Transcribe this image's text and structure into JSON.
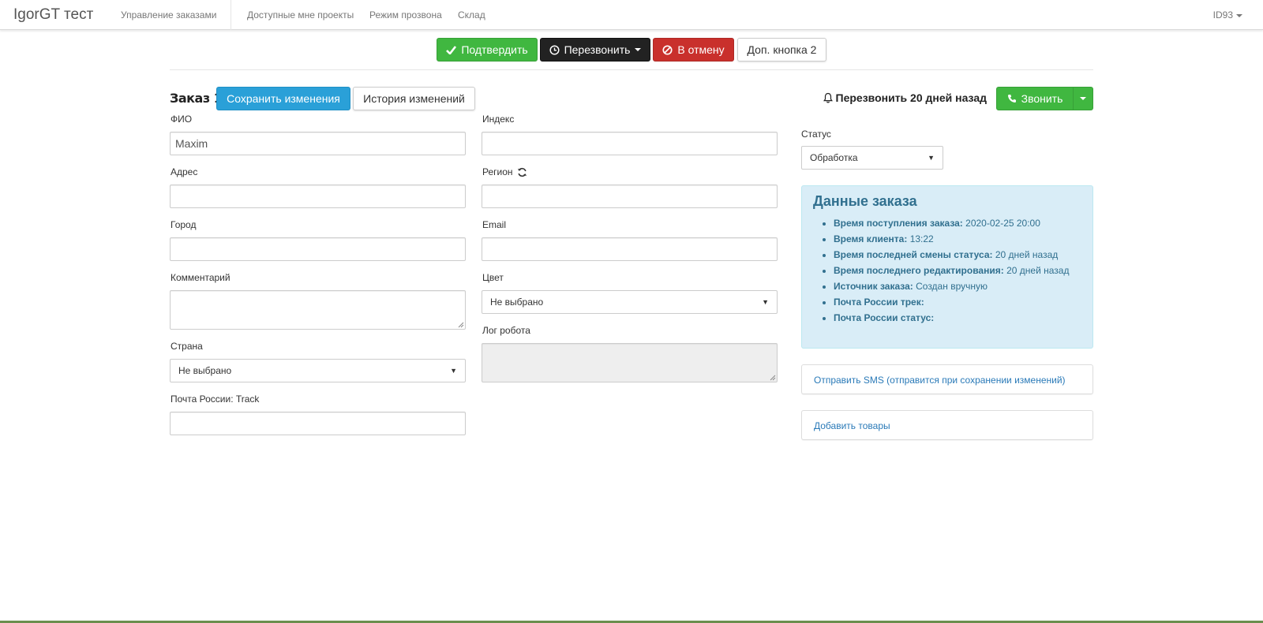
{
  "navbar": {
    "brand": "IgorGT тест",
    "links": [
      "Управление заказами",
      "Доступные мне проекты",
      "Режим прозвона",
      "Склад"
    ],
    "user": "ID93"
  },
  "actions": {
    "confirm": "Подтвердить",
    "callback": "Перезвонить",
    "cancel": "В отмену",
    "extra2": "Доп. кнопка 2"
  },
  "order": {
    "title": "Заказ 19",
    "save": "Сохранить изменения",
    "history": "История изменений",
    "callback_note": "Перезвонить 20 дней назад",
    "call": "Звонить"
  },
  "form": {
    "fio_label": "ФИО",
    "fio_value": "Maxim",
    "index_label": "Индекс",
    "address_label": "Адрес",
    "region_label": "Регион",
    "city_label": "Город",
    "email_label": "Email",
    "comment_label": "Комментарий",
    "color_label": "Цвет",
    "color_value": "Не выбрано",
    "robot_log_label": "Лог робота",
    "country_label": "Страна",
    "country_value": "Не выбрано",
    "track_label": "Почта России: Track"
  },
  "status": {
    "label": "Статус",
    "value": "Обработка"
  },
  "order_data": {
    "title": "Данные заказа",
    "items": [
      {
        "k": "Время поступления заказа:",
        "v": "2020-02-25 20:00"
      },
      {
        "k": "Время клиента:",
        "v": "13:22"
      },
      {
        "k": "Время последней смены статуса:",
        "v": "20 дней назад"
      },
      {
        "k": "Время последнего редактирования:",
        "v": "20 дней назад"
      },
      {
        "k": "Источник заказа:",
        "v": "Создан вручную"
      },
      {
        "k": "Почта России трек:",
        "v": ""
      },
      {
        "k": "Почта России статус:",
        "v": ""
      }
    ]
  },
  "links": {
    "sms": "Отправить SMS (отправится при сохранении изменений)",
    "add_goods": "Добавить товары"
  },
  "colors": {
    "success": "#40b740",
    "danger": "#c9302c",
    "primary": "#2aa0d8",
    "info_bg": "#d9edf7",
    "info_text": "#31708f"
  }
}
